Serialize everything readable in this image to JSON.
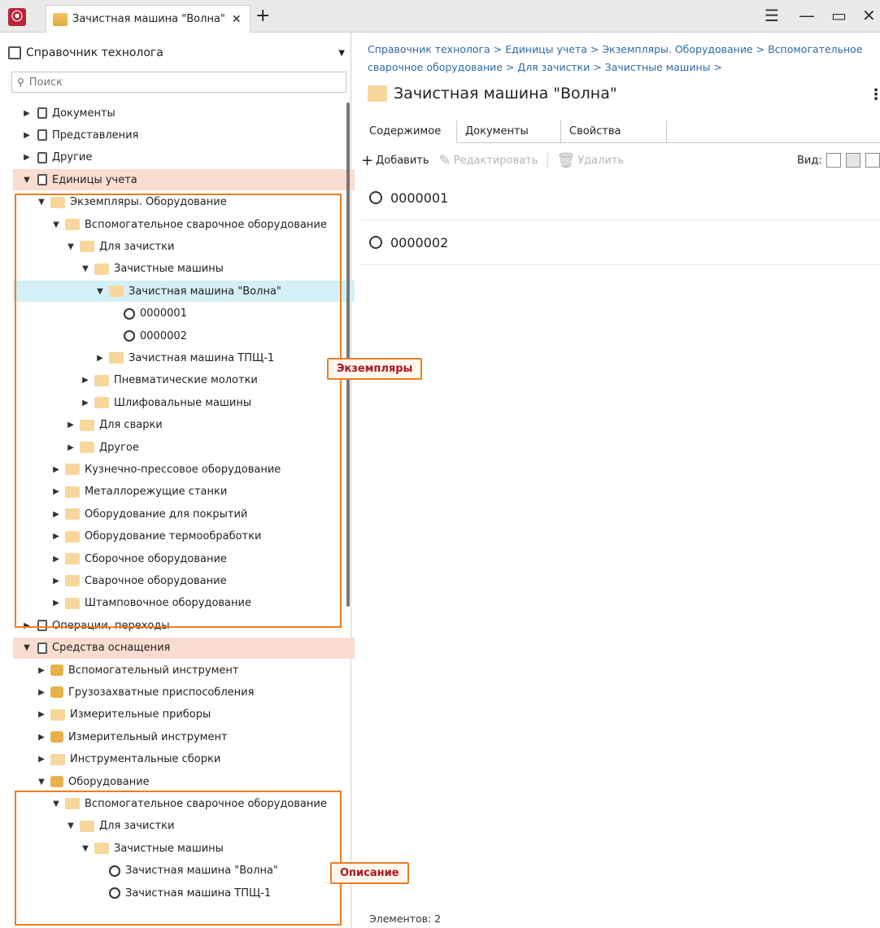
{
  "titlebar": {
    "app_logo": "logo",
    "tab_title": "Зачистная машина \"Волна\"",
    "close": "✕",
    "new_tab": "+",
    "menu": "☰",
    "minimize": "—",
    "maximize": "▭",
    "close_window": "✕"
  },
  "sidebar": {
    "catalog_label": "Справочник технолога",
    "search_placeholder": "Поиск",
    "tree": [
      {
        "label": "Документы",
        "level": 0,
        "icon": "book-icon",
        "state": "collapsed"
      },
      {
        "label": "Представления",
        "level": 0,
        "icon": "view-icon",
        "state": "collapsed"
      },
      {
        "label": "Другие",
        "level": 0,
        "icon": "book-icon",
        "state": "collapsed"
      },
      {
        "label": "Единицы учета",
        "level": 0,
        "icon": "book-icon",
        "state": "expanded",
        "highlight": "orange"
      },
      {
        "label": "Экземпляры. Оборудование",
        "level": 1,
        "icon": "folder-icon",
        "state": "expanded"
      },
      {
        "label": "Вспомогательное сварочное оборудование",
        "level": 2,
        "icon": "folder-icon",
        "state": "expanded"
      },
      {
        "label": "Для зачистки",
        "level": 3,
        "icon": "folder-icon",
        "state": "expanded"
      },
      {
        "label": "Зачистные машины",
        "level": 4,
        "icon": "folder-icon",
        "state": "expanded"
      },
      {
        "label": "Зачистная машина \"Волна\"",
        "level": 5,
        "icon": "folder-icon",
        "state": "expanded",
        "highlight": "blue"
      },
      {
        "label": "0000001",
        "level": 6,
        "icon": "instance-icon",
        "state": "leaf"
      },
      {
        "label": "0000002",
        "level": 6,
        "icon": "instance-icon",
        "state": "leaf"
      },
      {
        "label": "Зачистная машина ТПЩ-1",
        "level": 5,
        "icon": "folder-icon",
        "state": "collapsed"
      },
      {
        "label": "Пневматические молотки",
        "level": 4,
        "icon": "folder-icon",
        "state": "collapsed"
      },
      {
        "label": "Шлифовальные машины",
        "level": 4,
        "icon": "folder-icon",
        "state": "collapsed"
      },
      {
        "label": "Для сварки",
        "level": 3,
        "icon": "folder-icon",
        "state": "collapsed"
      },
      {
        "label": "Другое",
        "level": 3,
        "icon": "folder-icon",
        "state": "collapsed"
      },
      {
        "label": "Кузнечно-прессовое оборудование",
        "level": 2,
        "icon": "folder-icon",
        "state": "collapsed"
      },
      {
        "label": "Металлорежущие станки",
        "level": 2,
        "icon": "folder-icon",
        "state": "collapsed"
      },
      {
        "label": "Оборудование для покрытий",
        "level": 2,
        "icon": "folder-icon",
        "state": "collapsed"
      },
      {
        "label": "Оборудование термообработки",
        "level": 2,
        "icon": "folder-icon",
        "state": "collapsed"
      },
      {
        "label": "Сборочное оборудование",
        "level": 2,
        "icon": "folder-icon",
        "state": "collapsed"
      },
      {
        "label": "Сварочное оборудование",
        "level": 2,
        "icon": "folder-icon",
        "state": "collapsed"
      },
      {
        "label": "Штамповочное оборудование",
        "level": 2,
        "icon": "folder-icon",
        "state": "collapsed"
      },
      {
        "label": "Операции, переходы",
        "level": 0,
        "icon": "book-icon",
        "state": "collapsed"
      },
      {
        "label": "Средства оснащения",
        "level": 0,
        "icon": "book-icon",
        "state": "expanded",
        "highlight": "orange"
      },
      {
        "label": "Вспомогательный инструмент",
        "level": 1,
        "icon": "tool-icon",
        "state": "collapsed"
      },
      {
        "label": "Грузозахватные приспособления",
        "level": 1,
        "icon": "hook-icon",
        "state": "collapsed"
      },
      {
        "label": "Измерительные приборы",
        "level": 1,
        "icon": "folder-icon",
        "state": "collapsed"
      },
      {
        "label": "Измерительный инструмент",
        "level": 1,
        "icon": "caliper-icon",
        "state": "collapsed"
      },
      {
        "label": "Инструментальные сборки",
        "level": 1,
        "icon": "folder-icon",
        "state": "collapsed"
      },
      {
        "label": "Оборудование",
        "level": 1,
        "icon": "equipment-icon",
        "state": "expanded"
      },
      {
        "label": "Вспомогательное сварочное оборудование",
        "level": 2,
        "icon": "folder-icon",
        "state": "expanded"
      },
      {
        "label": "Для зачистки",
        "level": 3,
        "icon": "folder-icon",
        "state": "expanded"
      },
      {
        "label": "Зачистные машины",
        "level": 4,
        "icon": "folder-icon",
        "state": "expanded"
      },
      {
        "label": "Зачистная машина \"Волна\"",
        "level": 5,
        "icon": "instance-icon",
        "state": "leaf"
      },
      {
        "label": "Зачистная машина ТПЩ-1",
        "level": 5,
        "icon": "instance-icon",
        "state": "leaf"
      }
    ]
  },
  "annotations": {
    "callout_instances": "Экземпляры",
    "callout_description": "Описание"
  },
  "breadcrumb": {
    "items": [
      "Справочник технолога",
      "Единицы учета",
      "Экземпляры. Оборудование",
      "Вспомогательное сварочное оборудование",
      "Для зачистки",
      "Зачистные машины"
    ],
    "separator": " > "
  },
  "page": {
    "title": "Зачистная машина \"Волна\""
  },
  "tabs": [
    {
      "label": "Содержимое",
      "active": true
    },
    {
      "label": "Документы",
      "active": false
    },
    {
      "label": "Свойства",
      "active": false
    }
  ],
  "toolbar": {
    "add_label": "Добавить",
    "edit_label": "Редактировать",
    "delete_label": "Удалить",
    "view_label": "Вид:"
  },
  "content": {
    "items": [
      "0000001",
      "0000002"
    ]
  },
  "status": {
    "elements": "Элементов: 2"
  },
  "colors": {
    "highlight_orange": "#fbdcd0",
    "highlight_blue": "#d4f0f7",
    "annotation_border": "#ef7d22",
    "annotation_text": "#b0131e",
    "link": "#2d6aa4"
  }
}
